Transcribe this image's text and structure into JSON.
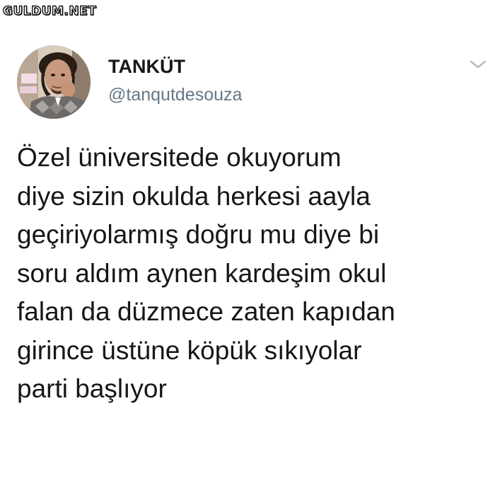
{
  "watermark": "GULDUM.NET",
  "tweet": {
    "author": {
      "display_name": "TANKÜT",
      "handle": "@tanqutdesouza"
    },
    "menu_icon": "chevron-down-icon",
    "text_lines": [
      "Özel üniversitede okuyorum",
      "diye sizin okulda herkesi aayla",
      "geçiriyolarmış doğru mu diye bi",
      "soru aldım aynen kardeşim okul",
      "falan da düzmece zaten kapıdan",
      "girince üstüne köpük sıkıyolar",
      "parti başlıyor"
    ]
  },
  "colors": {
    "text": "#14171a",
    "secondary_text": "#657786",
    "chevron": "#aab8c2",
    "background": "#ffffff"
  }
}
